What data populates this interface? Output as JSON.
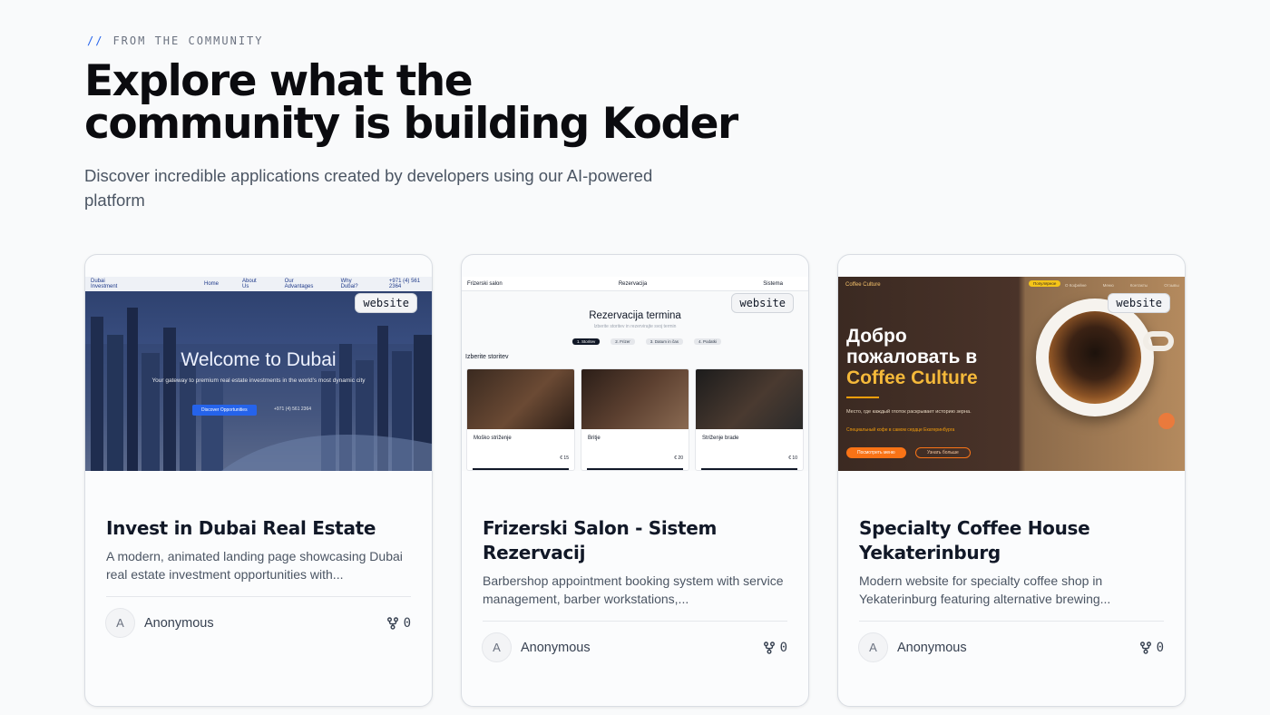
{
  "header": {
    "eyebrow_prefix": "//",
    "eyebrow": "FROM THE COMMUNITY",
    "title_line1": "Explore what the",
    "title_line2": "community is building Koder",
    "subtitle": "Discover incredible applications created by developers using our AI-powered platform"
  },
  "colors": {
    "accent": "#2563eb",
    "card_border": "#d9dde3",
    "muted": "#4b5563"
  },
  "cards": [
    {
      "tag": "website",
      "title": "Invest in Dubai Real Estate",
      "description": "A modern, animated landing page showcasing Dubai real estate investment opportunities with...",
      "author_initial": "A",
      "author": "Anonymous",
      "forks": "0",
      "preview": {
        "brand": "Dubai Investment",
        "nav": [
          "Home",
          "About Us",
          "Our Advantages",
          "Why Dubai?"
        ],
        "phone": "+971 (4) 561 2364",
        "headline": "Welcome to Dubai",
        "subline": "Your gateway to premium real estate investments in the world's most dynamic city",
        "cta": "Discover Opportunities",
        "cta_phone": "+971 (4) 561 2364"
      }
    },
    {
      "tag": "website",
      "title": "Frizerski Salon - Sistem Rezervacij",
      "description": "Barbershop appointment booking system with service management, barber workstations,...",
      "author_initial": "A",
      "author": "Anonymous",
      "forks": "0",
      "preview": {
        "brand": "Frizerski salon",
        "nav_center": "Rezervacija",
        "nav_right": "Sistema",
        "heading": "Rezervacija termina",
        "subheading": "Izberite storitev in rezervirajte svoj termin",
        "steps": [
          "1. Storitev",
          "2. Frizer",
          "3. Datum in čas",
          "4. Podatki"
        ],
        "section": "Izberite storitev",
        "services": [
          {
            "name": "Moško striženje",
            "price": "€ 15"
          },
          {
            "name": "Britje",
            "price": "€ 20"
          },
          {
            "name": "Striženje brade",
            "price": "€ 10"
          }
        ]
      }
    },
    {
      "tag": "website",
      "title": "Specialty Coffee House Yekaterinburg",
      "description": "Modern website for specialty coffee shop in Yekaterinburg featuring alternative brewing...",
      "author_initial": "A",
      "author": "Anonymous",
      "forks": "0",
      "preview": {
        "brand": "Coffee Culture",
        "pill": "Популярное",
        "nav": [
          "О Кофейне",
          "Меню",
          "Контакты",
          "Отзывы"
        ],
        "headline_line1": "Добро",
        "headline_line2": "пожаловать в",
        "headline_line3": "Coffee Culture",
        "text": "Место, где каждый глоток раскрывает историю зерна.",
        "accent_text": "Специальный кофе в самом сердце Екатеринбурга",
        "btn_primary": "Посмотреть меню",
        "btn_secondary": "Узнать больше"
      }
    }
  ]
}
